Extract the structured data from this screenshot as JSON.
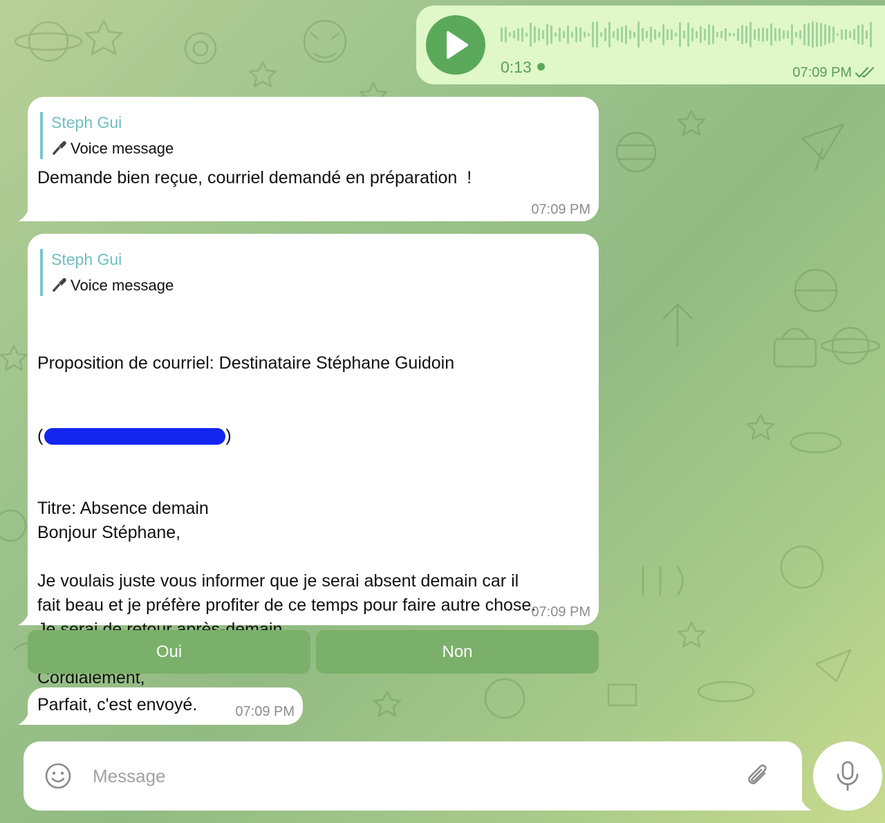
{
  "voice_out": {
    "duration": "0:13",
    "time": "07:09 PM",
    "status": "read"
  },
  "messages": [
    {
      "reply_name": "Steph Gui",
      "reply_text": "Voice message",
      "text": "Demande bien reçue, courriel demandé en préparation  !",
      "time": "07:09 PM"
    },
    {
      "reply_name": "Steph Gui",
      "reply_text": "Voice message",
      "line1": "Proposition de courriel: Destinataire Stéphane Guidoin",
      "open_paren": "(",
      "close_paren": ")",
      "body": "Titre: Absence demain\nBonjour Stéphane,\n\nJe voulais juste vous informer que je serai absent demain car il\nfait beau et je préfère profiter de ce temps pour faire autre chose.\nJe serai de retour après-demain.\n\nCordialement,\nRobert\n\nVoulez-vous procéder à l'envoi?",
      "time": "07:09 PM"
    },
    {
      "text": "Parfait, c'est envoyé.",
      "time": "07:09 PM"
    }
  ],
  "keyboard": {
    "yes": "Oui",
    "no": "Non"
  },
  "composer": {
    "placeholder": "Message"
  },
  "colors": {
    "outgoing_bubble": "#e0f7c8",
    "accent_green": "#5aa95a",
    "reply_accent": "#6fbfc2",
    "keyboard_button": "#7ab06a"
  }
}
